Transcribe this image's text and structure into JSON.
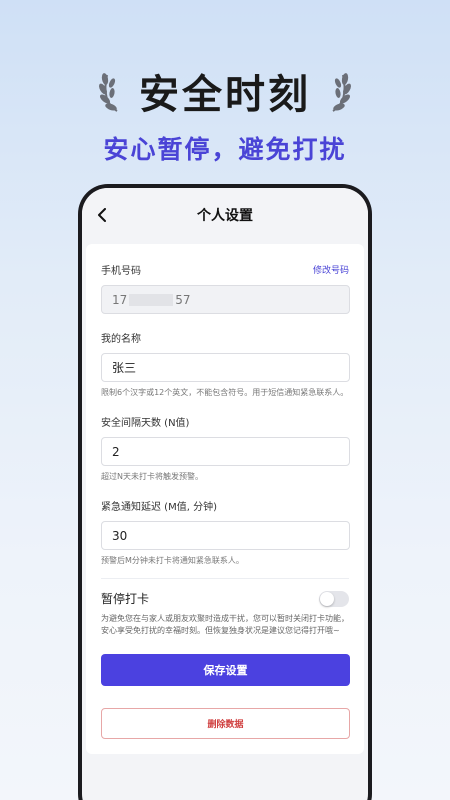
{
  "hero": {
    "title": "安全时刻",
    "subtitle": "安心暂停，避免打扰"
  },
  "nav": {
    "title": "个人设置"
  },
  "phone_field": {
    "label": "手机号码",
    "change_link": "修改号码",
    "value_prefix": "17",
    "value_suffix": "57"
  },
  "name_field": {
    "label": "我的名称",
    "value": "张三",
    "hint": "限制6个汉字或12个英文，不能包含符号。用于短信通知紧急联系人。"
  },
  "interval_field": {
    "label": "安全间隔天数 (N值)",
    "value": "2",
    "hint": "超过N天未打卡将触发预警。"
  },
  "delay_field": {
    "label": "紧急通知延迟 (M值, 分钟)",
    "value": "30",
    "hint": "预警后M分钟未打卡将通知紧急联系人。"
  },
  "pause": {
    "label": "暂停打卡",
    "enabled": false,
    "description": "为避免您在与家人或朋友欢聚时造成干扰，您可以暂时关闭打卡功能，安心享受免打扰的幸福时刻。但恢复独身状况是建议您记得打开哦~"
  },
  "actions": {
    "save_label": "保存设置",
    "delete_label": "删除数据"
  },
  "colors": {
    "accent": "#4b41e0",
    "danger": "#d04040"
  },
  "icons": {
    "back": "chevron-left-icon",
    "laurel": "laurel-icon"
  }
}
